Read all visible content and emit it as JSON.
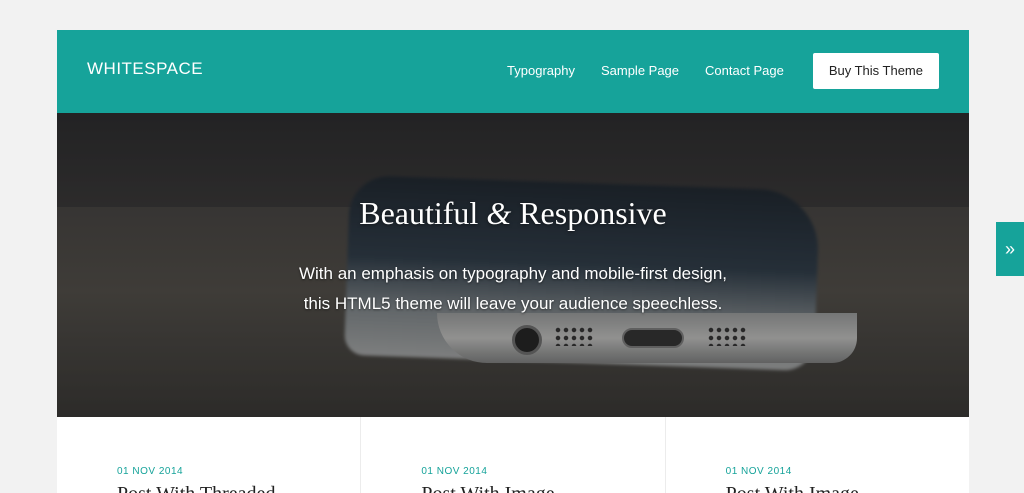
{
  "header": {
    "logo": "WHITESPACE",
    "nav": [
      "Typography",
      "Sample Page",
      "Contact Page"
    ],
    "buy_label": "Buy This Theme"
  },
  "hero": {
    "headline_pre": "Beautiful ",
    "headline_amp": "&",
    "headline_post": " Responsive",
    "tagline_line1": "With an emphasis on typography and mobile-first design,",
    "tagline_line2": "this HTML5 theme will leave your audience speechless."
  },
  "posts": [
    {
      "date": "01 NOV 2014",
      "title": "Post With Threaded"
    },
    {
      "date": "01 NOV 2014",
      "title": "Post With Image"
    },
    {
      "date": "01 NOV 2014",
      "title": "Post With Image"
    }
  ],
  "side_tab": {
    "label": "»"
  },
  "colors": {
    "accent": "#16a39a",
    "background": "#f2f2f2"
  }
}
